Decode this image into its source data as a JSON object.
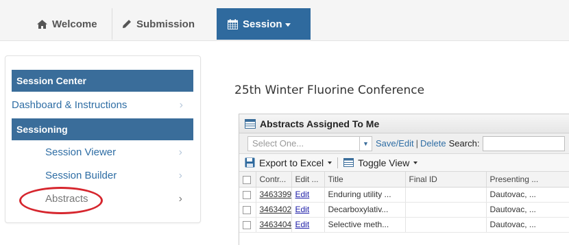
{
  "nav": {
    "welcome": "Welcome",
    "submission": "Submission",
    "session": "Session"
  },
  "sidebar": {
    "header1": "Session Center",
    "dashboard": "Dashboard & Instructions",
    "header2": "Sessioning",
    "items": [
      "Session Viewer",
      "Session Builder",
      "Abstracts"
    ]
  },
  "main": {
    "title": "25th Winter Fluorine Conference"
  },
  "panel": {
    "title": "Abstracts Assigned To Me",
    "select_placeholder": "Select One...",
    "save_edit": "Save/Edit",
    "delete": "Delete",
    "search_label": "Search:",
    "export": "Export to Excel",
    "toggle_view": "Toggle View",
    "columns": [
      "Contr...",
      "Edit ...",
      "Title",
      "Final ID",
      "Presenting ..."
    ],
    "rows": [
      {
        "control": "3463399",
        "edit": "Edit",
        "title": "Enduring utility ...",
        "final_id": "",
        "presenting": "Dautovac, ..."
      },
      {
        "control": "3463402",
        "edit": "Edit",
        "title": "Decarboxylativ...",
        "final_id": "",
        "presenting": "Dautovac, ..."
      },
      {
        "control": "3463404",
        "edit": "Edit",
        "title": "Selective meth...",
        "final_id": "",
        "presenting": "Dautovac, ..."
      }
    ]
  },
  "colors": {
    "accent": "#2f6a9e",
    "link": "#2e6da4",
    "highlight_ring": "#d6262e"
  }
}
